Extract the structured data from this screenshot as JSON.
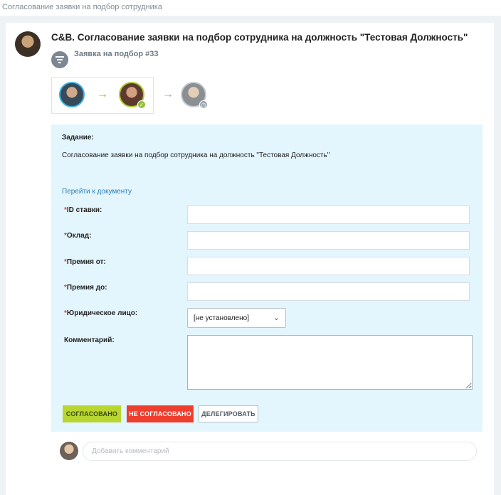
{
  "window": {
    "title": "Согласование заявки на подбор сотрудника"
  },
  "task": {
    "title": "C&B. Согласование заявки на подбор сотрудника на должность \"Тестовая Должность\"",
    "request_label": "Заявка на подбор #33",
    "icons": {
      "request": "filter-list-icon",
      "route_arrow": "arrow-right-icon",
      "approved_badge": "check-icon",
      "pending_badge": "clock-icon"
    },
    "route": [
      {
        "state": "current",
        "ring_color": "#3bb1df"
      },
      {
        "state": "approved",
        "ring_color": "#aacc2f"
      },
      {
        "state": "pending",
        "ring_color": "#c5ccd2"
      }
    ],
    "assignment_heading": "Задание:",
    "assignment_text": "Согласование заявки на подбор сотрудника на должность \"Тестовая Должность\"",
    "document_link": "Перейти к документу"
  },
  "form": {
    "required_mark": "*",
    "fields": {
      "rate_id": {
        "label": "ID ставки:",
        "value": ""
      },
      "salary": {
        "label": "Оклад:",
        "value": ""
      },
      "bonus_from": {
        "label": "Премия от:",
        "value": ""
      },
      "bonus_to": {
        "label": "Премия до:",
        "value": ""
      },
      "legal_entity": {
        "label": "Юридическое лицо:",
        "selected": "[не установлено]"
      },
      "comment": {
        "label": "Комментарий:",
        "value": ""
      }
    },
    "buttons": {
      "approve": "СОГЛАСОВАНО",
      "reject": "НЕ СОГЛАСОВАНО",
      "delegate": "ДЕЛЕГИРОВАТЬ"
    }
  },
  "comments": {
    "placeholder": "Добавить комментарий"
  },
  "colors": {
    "panel_bg": "#e3f5fd",
    "approve": "#b8d62f",
    "reject": "#ee3e2e",
    "link": "#2f7fb5",
    "required": "#e0413a"
  }
}
